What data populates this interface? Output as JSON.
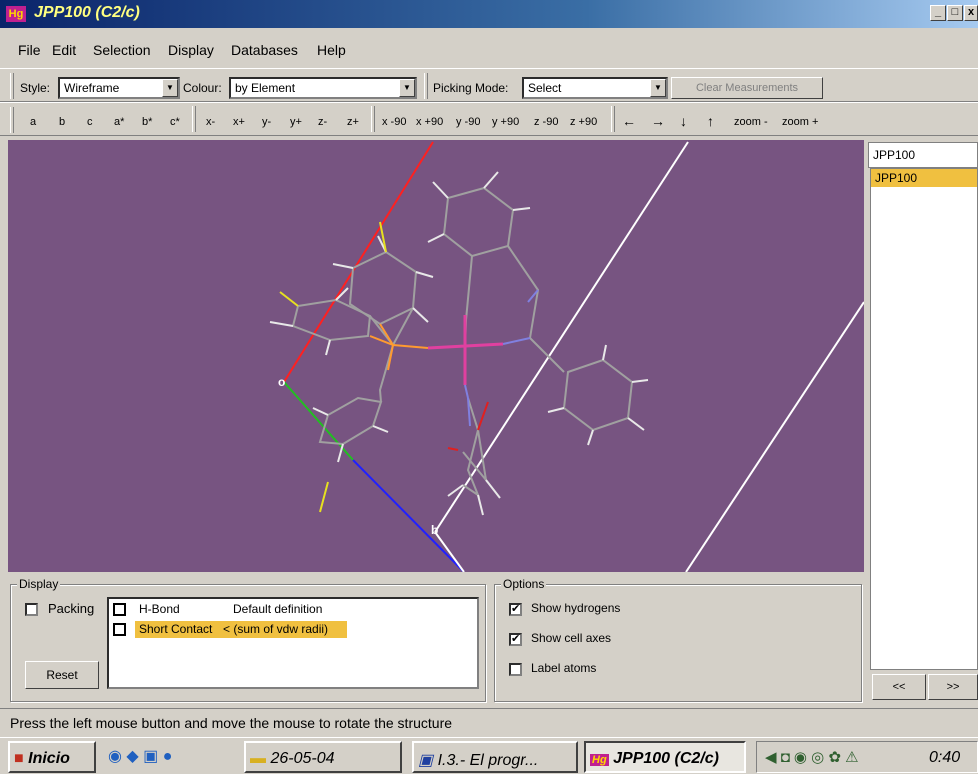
{
  "window": {
    "title": "JPP100 (C2/c)",
    "logo": "Hg",
    "controls": [
      "_",
      "□",
      "x"
    ]
  },
  "menu": [
    "File",
    "Edit",
    "Selection",
    "Display",
    "Databases",
    "Help"
  ],
  "toolbar1": {
    "style_label": "Style:",
    "style_value": "Wireframe",
    "colour_label": "Colour:",
    "colour_value": "by Element",
    "picking_label": "Picking Mode:",
    "picking_value": "Select",
    "clear_label": "Clear Measurements"
  },
  "toolbar2": {
    "axis_buttons": [
      "a",
      "b",
      "c",
      "a*",
      "b*",
      "c*"
    ],
    "move_buttons": [
      "x-",
      "x+",
      "y-",
      "y+",
      "z-",
      "z+"
    ],
    "rotate_buttons": [
      "x -90",
      "x +90",
      "y -90",
      "y +90",
      "z -90",
      "z +90"
    ],
    "arrows": [
      "←",
      "→",
      "↓",
      "↑"
    ],
    "zoom_buttons": [
      "zoom -",
      "zoom +"
    ]
  },
  "viewport": {
    "axis_labels": {
      "origin": "o",
      "b": "b"
    },
    "background": "#775481"
  },
  "structures": {
    "current": "JPP100",
    "list": [
      "JPP100"
    ],
    "nav": [
      "<<",
      ">>"
    ]
  },
  "display_group": {
    "caption": "Display",
    "packing_label": "Packing",
    "reset_label": "Reset",
    "contacts": [
      {
        "name": "H-Bond",
        "definition": "Default definition"
      },
      {
        "name": "Short Contact",
        "definition": "< (sum of vdw radii)"
      }
    ]
  },
  "options_group": {
    "caption": "Options",
    "items": [
      {
        "label": "Show hydrogens",
        "checked": "✔"
      },
      {
        "label": "Show cell axes",
        "checked": "✔"
      },
      {
        "label": "Label atoms",
        "checked": ""
      }
    ]
  },
  "status": "Press the left mouse button and move the mouse to rotate the structure",
  "taskbar": {
    "start": "Inicio",
    "folder": "26-05-04",
    "word": "I.3.- El progr...",
    "app": "JPP100 (C2/c)",
    "clock": "0:40"
  }
}
